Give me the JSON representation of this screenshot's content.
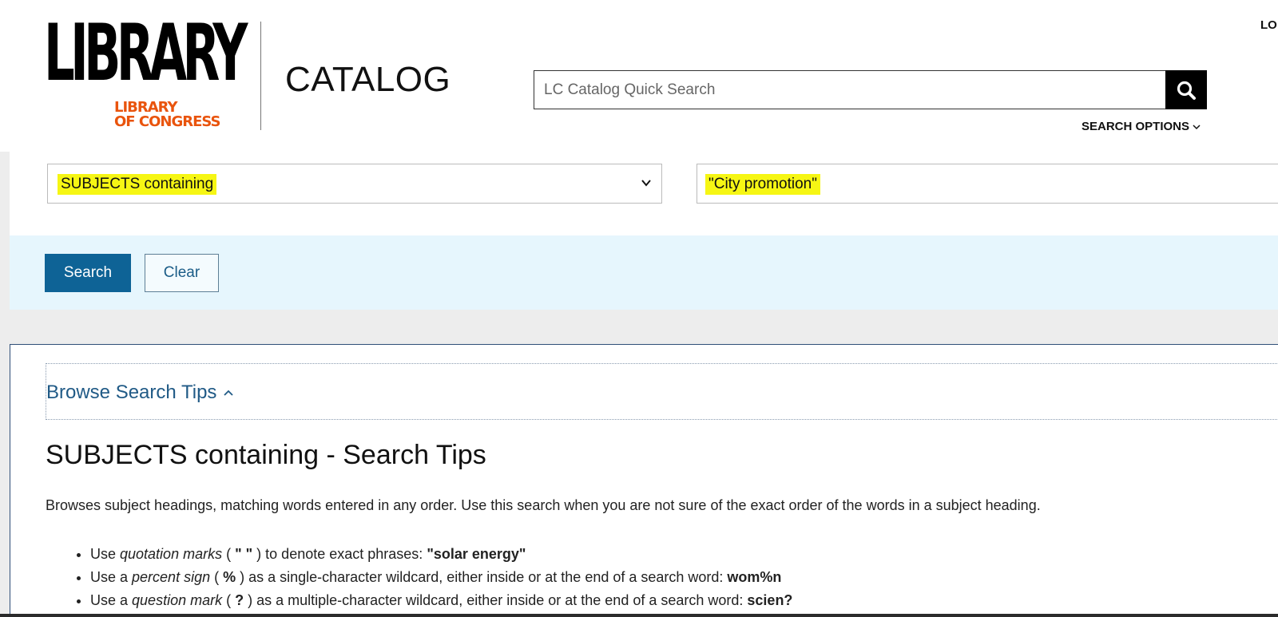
{
  "header": {
    "logo_big": "LIBRARY",
    "logo_sub_1": "LIBRARY",
    "logo_sub_2": "OF CONGRESS",
    "catalog_title": "CATALOG",
    "login_label": "LO",
    "quick_search_placeholder": "LC Catalog Quick Search",
    "search_options_label": "SEARCH OPTIONS"
  },
  "form": {
    "search_type_selected": "SUBJECTS containing",
    "search_term_value": "\"City promotion\"",
    "search_button_label": "Search",
    "clear_button_label": "Clear"
  },
  "tips": {
    "toggle_label": "Browse Search Tips",
    "heading": "SUBJECTS containing - Search Tips",
    "description": "Browses subject headings, matching words entered in any order. Use this search when you are not sure of the exact order of the words in a subject heading.",
    "items": [
      {
        "prefix": "Use ",
        "term": "quotation marks",
        "symbol_open": " ( ",
        "symbol": "\" \"",
        "symbol_close": " ) ",
        "rest": "to denote exact phrases: ",
        "example": "\"solar energy\""
      },
      {
        "prefix": "Use a ",
        "term": "percent sign",
        "symbol_open": " ( ",
        "symbol": "%",
        "symbol_close": " ) ",
        "rest": "as a single-character wildcard, either inside or at the end of a search word: ",
        "example": "wom%n"
      },
      {
        "prefix": "Use a ",
        "term": "question mark",
        "symbol_open": " ( ",
        "symbol": "?",
        "symbol_close": " ) ",
        "rest": "as a multiple-character wildcard, either inside or at the end of a search word: ",
        "example": "scien?"
      }
    ]
  },
  "colors": {
    "logo_accent": "#e9540d",
    "primary_button": "#0e6396",
    "highlight": "#f6f614",
    "button_bar_bg": "#e6f6fd"
  },
  "icons": {
    "search": "search-icon",
    "chevron_down": "chevron-down-icon",
    "chevron_up": "chevron-up-icon"
  }
}
